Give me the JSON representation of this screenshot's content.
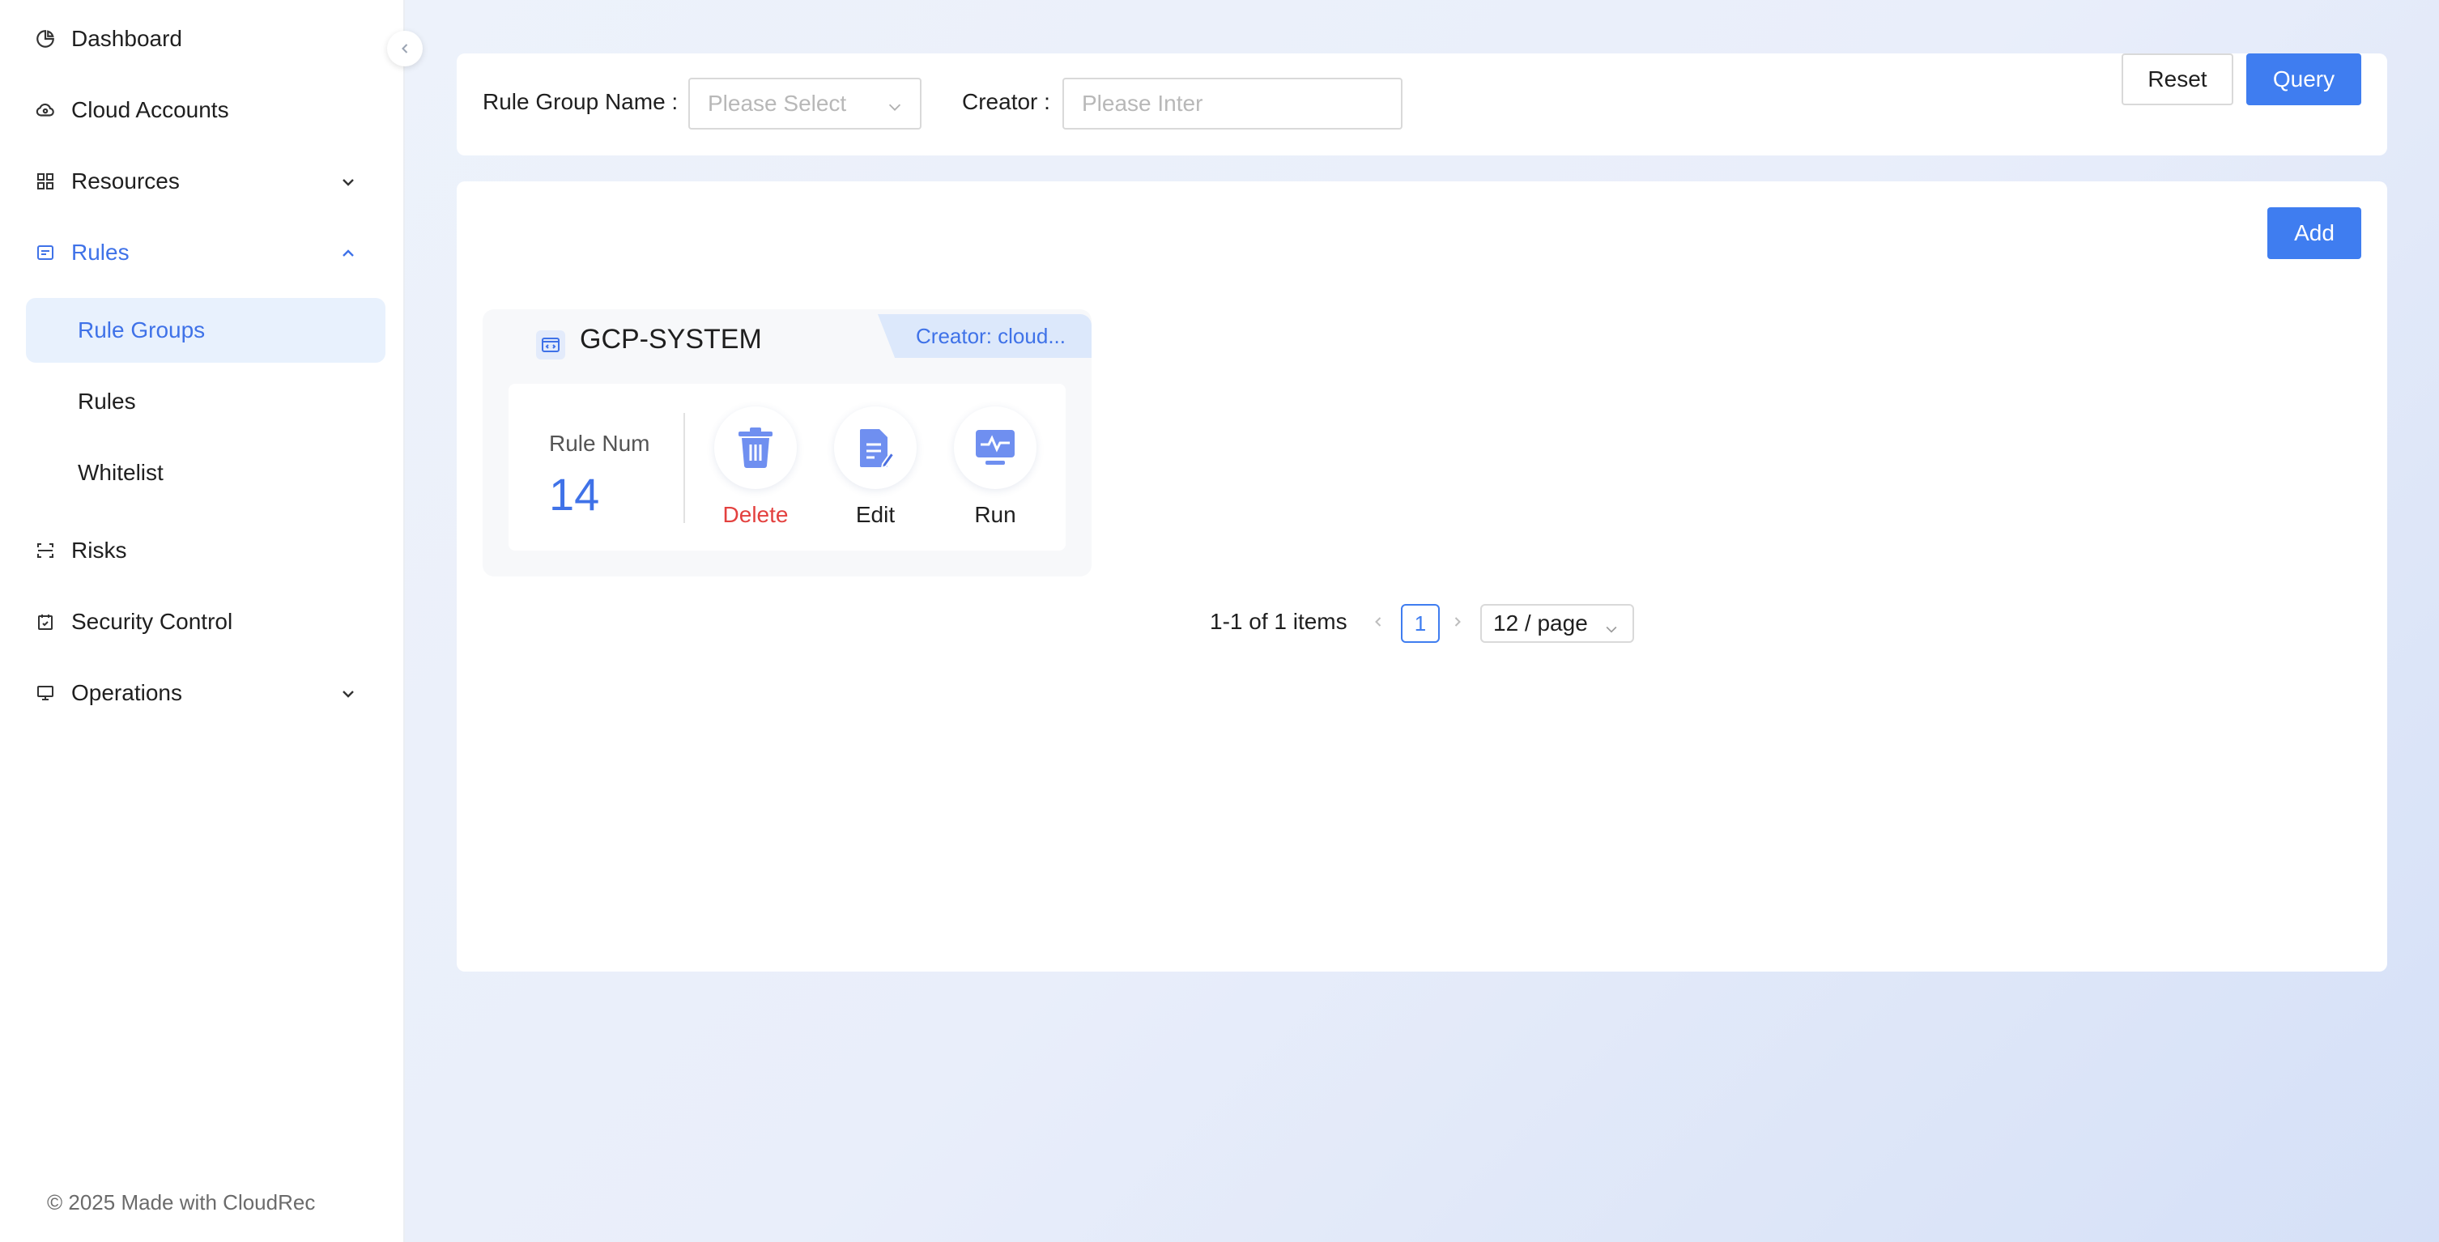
{
  "sidebar": {
    "items": [
      {
        "label": "Dashboard",
        "icon": "pie-chart-icon"
      },
      {
        "label": "Cloud Accounts",
        "icon": "cloud-icon"
      },
      {
        "label": "Resources",
        "icon": "grid-icon",
        "expandable": true
      },
      {
        "label": "Rules",
        "icon": "rules-icon",
        "expanded": true
      },
      {
        "label": "Risks",
        "icon": "scan-icon"
      },
      {
        "label": "Security Control",
        "icon": "calendar-check-icon"
      },
      {
        "label": "Operations",
        "icon": "monitor-icon",
        "expandable": true
      }
    ],
    "sub_items": [
      {
        "label": "Rule Groups",
        "selected": true
      },
      {
        "label": "Rules",
        "selected": false
      },
      {
        "label": "Whitelist",
        "selected": false
      }
    ],
    "footer": "© 2025 Made with CloudRec"
  },
  "filter": {
    "rule_group_label": "Rule Group Name",
    "rule_group_placeholder": "Please Select",
    "creator_label": "Creator",
    "creator_placeholder": "Please Inter",
    "reset_label": "Reset",
    "query_label": "Query"
  },
  "main": {
    "add_label": "Add",
    "cards": [
      {
        "title": "GCP-SYSTEM",
        "creator": "Creator: cloud...",
        "rule_num_label": "Rule Num",
        "rule_num": "14",
        "actions": {
          "delete": "Delete",
          "edit": "Edit",
          "run": "Run"
        }
      }
    ],
    "pagination": {
      "total": "1-1 of 1 items",
      "current_page": "1",
      "page_size": "12 / page"
    }
  },
  "colors": {
    "primary": "#3f7df0",
    "accent_text": "#3f72e8",
    "danger": "#e3413f",
    "selected_bg": "#e8f1fd"
  }
}
